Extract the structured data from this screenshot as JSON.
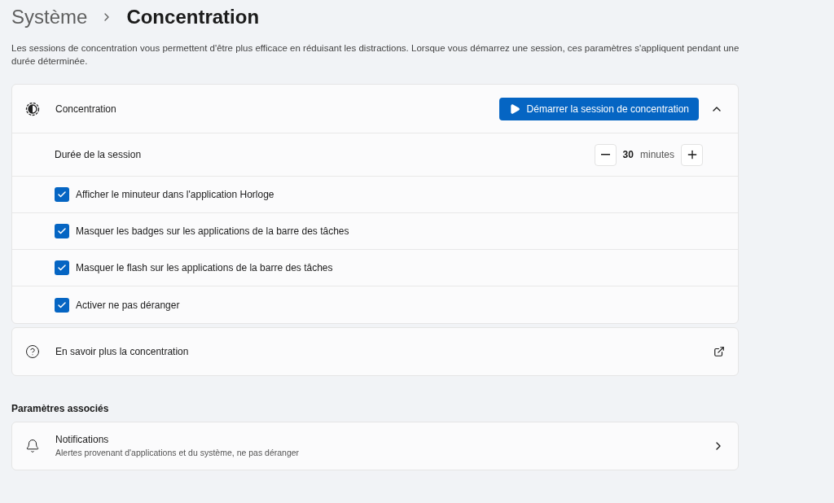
{
  "breadcrumb": {
    "parent": "Système",
    "current": "Concentration"
  },
  "description": "Les sessions de concentration vous permettent d'être plus efficace en réduisant les distractions. Lorsque vous démarrez une session, ces paramètres s'appliquent pendant une durée déterminée.",
  "focus_card": {
    "title": "Concentration",
    "start_button": "Démarrer la session de concentration",
    "expanded": true,
    "duration": {
      "label": "Durée de la session",
      "value": "30",
      "unit": "minutes"
    },
    "options": [
      {
        "label": "Afficher le minuteur dans l'application Horloge",
        "checked": true
      },
      {
        "label": "Masquer les badges sur les applications de la barre des tâches",
        "checked": true
      },
      {
        "label": "Masquer le flash sur les applications de la barre des tâches",
        "checked": true
      },
      {
        "label": "Activer ne pas déranger",
        "checked": true
      }
    ]
  },
  "learn_more": {
    "label": "En savoir plus la concentration"
  },
  "related": {
    "heading": "Paramètres associés",
    "items": [
      {
        "title": "Notifications",
        "subtitle": "Alertes provenant d'applications et du système, ne pas déranger"
      }
    ]
  }
}
